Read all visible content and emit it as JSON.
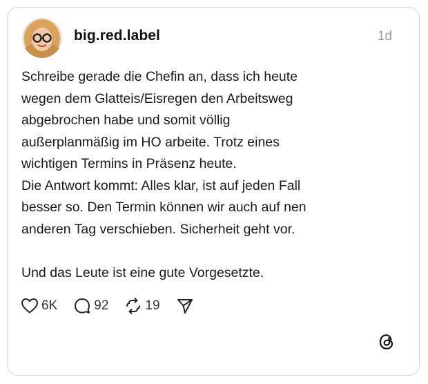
{
  "post": {
    "username": "big.red.label",
    "timestamp": "1d",
    "body_lines": [
      "Schreibe gerade die Chefin an, dass ich heute",
      "wegen dem Glatteis/Eisregen den Arbeitsweg",
      "abgebrochen habe und somit völlig",
      "außerplanmäßig im HO arbeite. Trotz eines",
      "wichtigen Termins in Präsenz heute.",
      "Die Antwort kommt: Alles klar, ist auf jeden Fall",
      "besser so. Den Termin können wir auch auf nen",
      "anderen Tag verschieben. Sicherheit geht vor.",
      "",
      "Und das Leute ist eine gute Vorgesetzte."
    ],
    "actions": {
      "likes": "6K",
      "replies": "92",
      "reposts": "19"
    }
  },
  "icons": {
    "avatar": "avatar-icon",
    "like": "heart-icon",
    "reply": "speech-bubble-icon",
    "repost": "repost-icon",
    "share": "send-icon",
    "brand": "threads-logo-icon"
  },
  "colors": {
    "border": "#d9d9d9",
    "text": "#1a1a1a",
    "muted": "#9a9a9a"
  }
}
